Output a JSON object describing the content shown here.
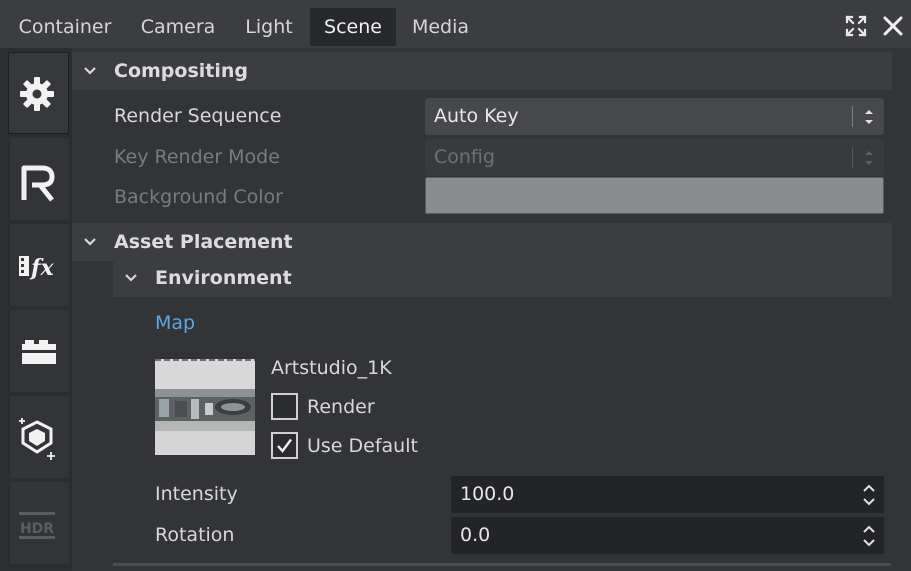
{
  "tabs": [
    {
      "label": "Container",
      "active": false
    },
    {
      "label": "Camera",
      "active": false
    },
    {
      "label": "Light",
      "active": false
    },
    {
      "label": "Scene",
      "active": true
    },
    {
      "label": "Media",
      "active": false
    }
  ],
  "window_controls": {
    "maximize_icon": "maximize-icon",
    "close_icon": "close-icon"
  },
  "sidebar": {
    "items": [
      {
        "icon": "gear-icon",
        "active": true
      },
      {
        "icon": "render-r-icon",
        "active": false
      },
      {
        "icon": "fx-icon",
        "active": false
      },
      {
        "icon": "layers-icon",
        "active": false
      },
      {
        "icon": "shield-placement-icon",
        "active": false
      },
      {
        "label": "HDR",
        "icon": "hdr-icon",
        "active": false
      }
    ]
  },
  "compositing": {
    "title": "Compositing",
    "render_sequence": {
      "label": "Render Sequence",
      "value": "Auto Key"
    },
    "key_render_mode": {
      "label": "Key Render Mode",
      "value": "Config",
      "disabled": true
    },
    "background_color": {
      "label": "Background Color",
      "value": "#8b8c8e",
      "disabled": true
    }
  },
  "asset_placement": {
    "title": "Asset Placement",
    "environment": {
      "title": "Environment",
      "map_link": "Map",
      "map_name": "Artstudio_1K",
      "render": {
        "label": "Render",
        "checked": false
      },
      "use_default": {
        "label": "Use Default",
        "checked": true
      },
      "intensity": {
        "label": "Intensity",
        "value": "100.0"
      },
      "rotation": {
        "label": "Rotation",
        "value": "0.0"
      }
    }
  },
  "colors": {
    "accent_link": "#5aa7e6",
    "panel": "#323437",
    "header": "#3b3d40"
  }
}
